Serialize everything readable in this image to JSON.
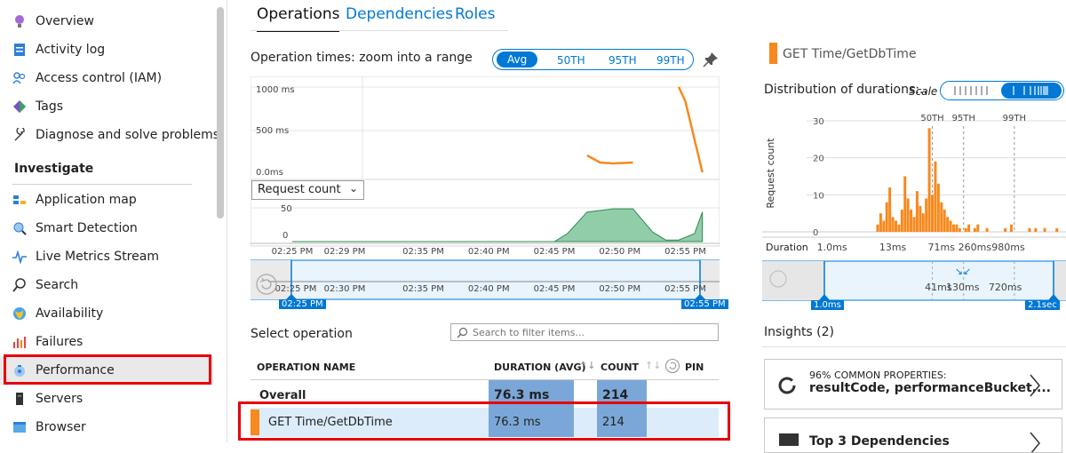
{
  "sidebar": {
    "items_top": [
      {
        "label": "Overview",
        "icon": "lightbulb-icon"
      },
      {
        "label": "Activity log",
        "icon": "activity-log-icon"
      },
      {
        "label": "Access control (IAM)",
        "icon": "people-icon"
      },
      {
        "label": "Tags",
        "icon": "tag-icon"
      },
      {
        "label": "Diagnose and solve problems",
        "icon": "wrench-icon"
      }
    ],
    "section_investigate": "Investigate",
    "items_investigate": [
      {
        "label": "Application map",
        "icon": "app-map-icon"
      },
      {
        "label": "Smart Detection",
        "icon": "smart-detection-icon"
      },
      {
        "label": "Live Metrics Stream",
        "icon": "pulse-icon"
      },
      {
        "label": "Search",
        "icon": "search-icon"
      },
      {
        "label": "Availability",
        "icon": "globe-icon"
      },
      {
        "label": "Failures",
        "icon": "failures-chart-icon"
      },
      {
        "label": "Performance",
        "icon": "performance-icon",
        "selected": true
      },
      {
        "label": "Servers",
        "icon": "server-icon"
      },
      {
        "label": "Browser",
        "icon": "browser-icon"
      }
    ]
  },
  "tabs": [
    {
      "label": "Operations",
      "active": true
    },
    {
      "label": "Dependencies",
      "active": false
    },
    {
      "label": "Roles",
      "active": false
    }
  ],
  "operation_times": {
    "title": "Operation times: zoom into a range",
    "percentile_pills": [
      "Avg",
      "50TH",
      "95TH",
      "99TH"
    ],
    "selected_pill": "Avg",
    "pin_icon": "pin-icon"
  },
  "chart_data": [
    {
      "type": "line",
      "title": "",
      "y_tick_labels": [
        "1000 ms",
        "500 ms",
        "0.0ms"
      ],
      "ylim": [
        0,
        1000
      ],
      "x_tick_labels": [
        "02:25 PM",
        "02:29 PM",
        "02:35 PM",
        "02:40 PM",
        "02:45 PM",
        "02:50 PM",
        "02:55 PM"
      ],
      "series": [
        {
          "x": [
            47.5,
            48.5,
            49.5,
            51.0,
            54.5,
            55.0,
            56.3
          ],
          "values": [
            230,
            150,
            140,
            150,
            1000,
            840,
            40
          ],
          "color": "#f7891e"
        }
      ]
    },
    {
      "type": "area",
      "title": "",
      "selector_label": "Request count",
      "y_tick_labels": [
        "50",
        "0"
      ],
      "ylim": [
        0,
        50
      ],
      "series": [
        {
          "x": [
            0,
            45.0,
            46.0,
            47.5,
            49.5,
            51.0,
            52.5,
            53.5,
            54.5,
            55.7,
            56.3
          ],
          "values": [
            0,
            0,
            10,
            37,
            41,
            41,
            12,
            2,
            2,
            10,
            37
          ],
          "color": "#64b886"
        }
      ]
    },
    {
      "type": "bar",
      "title": "Distribution of durations:..",
      "ylabel": "Request count",
      "y_tick_labels": [
        "30",
        "20",
        "10",
        "0"
      ],
      "ylim": [
        0,
        33
      ],
      "percentile_markers": [
        "50TH",
        "95TH",
        "99TH"
      ],
      "x_tick_labels": [
        "1.0ms",
        "13ms",
        "71ms",
        "260ms",
        "980ms"
      ],
      "bars": [
        {
          "x": 0.38,
          "value": 2
        },
        {
          "x": 0.39,
          "value": 5
        },
        {
          "x": 0.4,
          "value": 3
        },
        {
          "x": 0.41,
          "value": 8
        },
        {
          "x": 0.42,
          "value": 12
        },
        {
          "x": 0.43,
          "value": 4
        },
        {
          "x": 0.44,
          "value": 3
        },
        {
          "x": 0.45,
          "value": 2
        },
        {
          "x": 0.46,
          "value": 6
        },
        {
          "x": 0.47,
          "value": 15
        },
        {
          "x": 0.48,
          "value": 9
        },
        {
          "x": 0.49,
          "value": 6
        },
        {
          "x": 0.5,
          "value": 4
        },
        {
          "x": 0.51,
          "value": 11
        },
        {
          "x": 0.52,
          "value": 7
        },
        {
          "x": 0.53,
          "value": 5
        },
        {
          "x": 0.54,
          "value": 9
        },
        {
          "x": 0.55,
          "value": 28
        },
        {
          "x": 0.56,
          "value": 10
        },
        {
          "x": 0.57,
          "value": 19
        },
        {
          "x": 0.58,
          "value": 13
        },
        {
          "x": 0.59,
          "value": 8
        },
        {
          "x": 0.6,
          "value": 6
        },
        {
          "x": 0.61,
          "value": 4
        },
        {
          "x": 0.62,
          "value": 3
        },
        {
          "x": 0.63,
          "value": 2
        },
        {
          "x": 0.64,
          "value": 2
        },
        {
          "x": 0.65,
          "value": 1
        },
        {
          "x": 0.67,
          "value": 1
        },
        {
          "x": 0.68,
          "value": 2
        },
        {
          "x": 0.7,
          "value": 1
        },
        {
          "x": 0.71,
          "value": 2
        },
        {
          "x": 0.74,
          "value": 1
        },
        {
          "x": 0.8,
          "value": 1
        },
        {
          "x": 0.82,
          "value": 2
        },
        {
          "x": 0.88,
          "value": 1
        },
        {
          "x": 0.9,
          "value": 1
        },
        {
          "x": 0.93,
          "value": 1
        },
        {
          "x": 0.97,
          "value": 1
        }
      ],
      "color": "#f7891e"
    }
  ],
  "time_range": {
    "x_tick_labels": [
      "02:25 PM",
      "02:30 PM",
      "02:35 PM",
      "02:40 PM",
      "02:45 PM",
      "02:50 PM",
      "02:55 PM"
    ],
    "start_label": "02:25 PM",
    "end_label": "02:55 PM"
  },
  "select_operation": {
    "label": "Select operation",
    "search_placeholder": "Search to filter items...",
    "columns": {
      "name": "OPERATION NAME",
      "duration": "DURATION (AVG)",
      "count": "COUNT",
      "pin": "PIN"
    },
    "rows": [
      {
        "name": "Overall",
        "duration": "76.3 ms",
        "count": "214",
        "bold": true
      },
      {
        "name": "GET Time/GetDbTime",
        "duration": "76.3 ms",
        "count": "214",
        "bold": false,
        "selected": true
      }
    ]
  },
  "right_panel": {
    "title": "GET Time/GetDbTime",
    "title_color": "#f7891e",
    "scale_label": "Scale",
    "duration_label": "Duration",
    "duration_range_labels": [
      "41ms",
      "130ms",
      "720ms"
    ],
    "range_start": "1.0ms",
    "range_end": "2.1sec",
    "insights_title": "Insights (2)",
    "insight_card": {
      "heading": "96% COMMON PROPERTIES:",
      "detail": "resultCode, performanceBucket,..."
    },
    "insight_card2": {
      "heading": "Top 3 Dependencies"
    }
  },
  "colors": {
    "accent": "#0078d4",
    "orange": "#f7891e",
    "green": "#64b886",
    "highlight": "#e8000b",
    "row_selected": "#dcecfb",
    "duration_bar": "#7ba7d8"
  }
}
